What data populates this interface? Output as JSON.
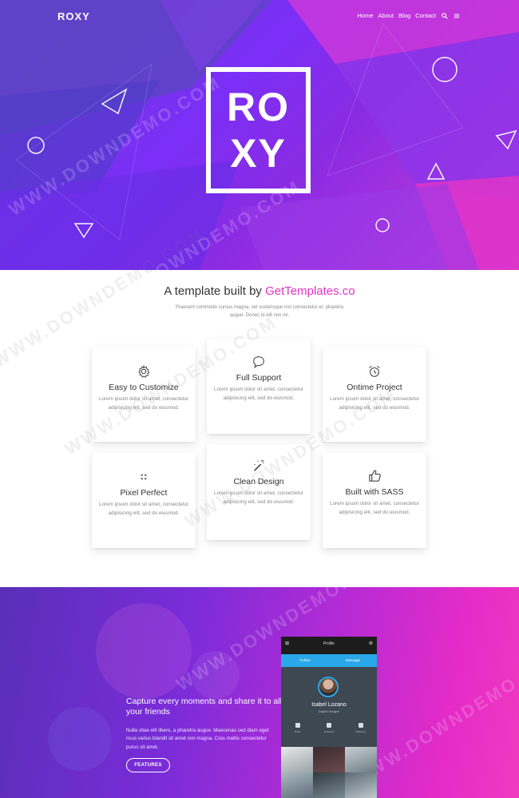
{
  "header": {
    "logo": "ROXY",
    "nav": [
      "Home",
      "About",
      "Blog",
      "Contact"
    ],
    "icons": [
      "search-icon",
      "menu-icon"
    ]
  },
  "hero": {
    "logo_line1": "RO",
    "logo_line2": "XY"
  },
  "intro": {
    "title_prefix": "A template built by ",
    "title_brand": "GetTemplates.co",
    "subtitle": "Praesent commodo cursus magna, vel scelerisque nisl consectetur et. pharetra augue. Donec id elit non mi."
  },
  "features": [
    {
      "icon": "gear-icon",
      "title": "Easy to Customize",
      "text": "Lorem ipsum dolor sit amet, consectetur adipisicing elit, sed do eiusmod."
    },
    {
      "icon": "chat-icon",
      "title": "Full Support",
      "text": "Lorem ipsum dolor sit amet, consectetur adipisicing elit, sed do eiusmod."
    },
    {
      "icon": "alarm-clock-icon",
      "title": "Ontime Project",
      "text": "Lorem ipsum dolor sit amet, consectetur adipisicing elit, sed do eiusmod."
    },
    {
      "icon": "pixel-icon",
      "title": "Pixel Perfect",
      "text": "Lorem ipsum dolor sit amet, consectetur adipisicing elit, sed do eiusmod."
    },
    {
      "icon": "magic-wand-icon",
      "title": "Clean Design",
      "text": "Lorem ipsum dolor sit amet, consectetur adipisicing elit, sed do eiusmod."
    },
    {
      "icon": "thumbs-up-icon",
      "title": "Built with SASS",
      "text": "Lorem ipsum dolor sit amet, consectetur adipisicing elit, sed do eiusmod."
    }
  ],
  "showcase": {
    "title": "Capture every moments and share it to all your friends",
    "text": "Nulla vitae elit libero, a pharetra augue. Maecenas sed diam eget risus varius blandit sit amet non magna. Cras mattis consectetur purus sit amet.",
    "button": "FEATURES"
  },
  "phone": {
    "header_title": "Profile",
    "tabs": [
      "Follow",
      "Message"
    ],
    "name": "Isabel Lozano",
    "role": "Graphic Designer",
    "stats": [
      "Posts",
      "Followers",
      "Following"
    ]
  },
  "watermark": "WWW.DOWNDEMO.COM",
  "colors": {
    "brand_pink": "#e033c4",
    "hero_purple": "#7b2ff7",
    "phone_blue": "#2aa7e8"
  }
}
